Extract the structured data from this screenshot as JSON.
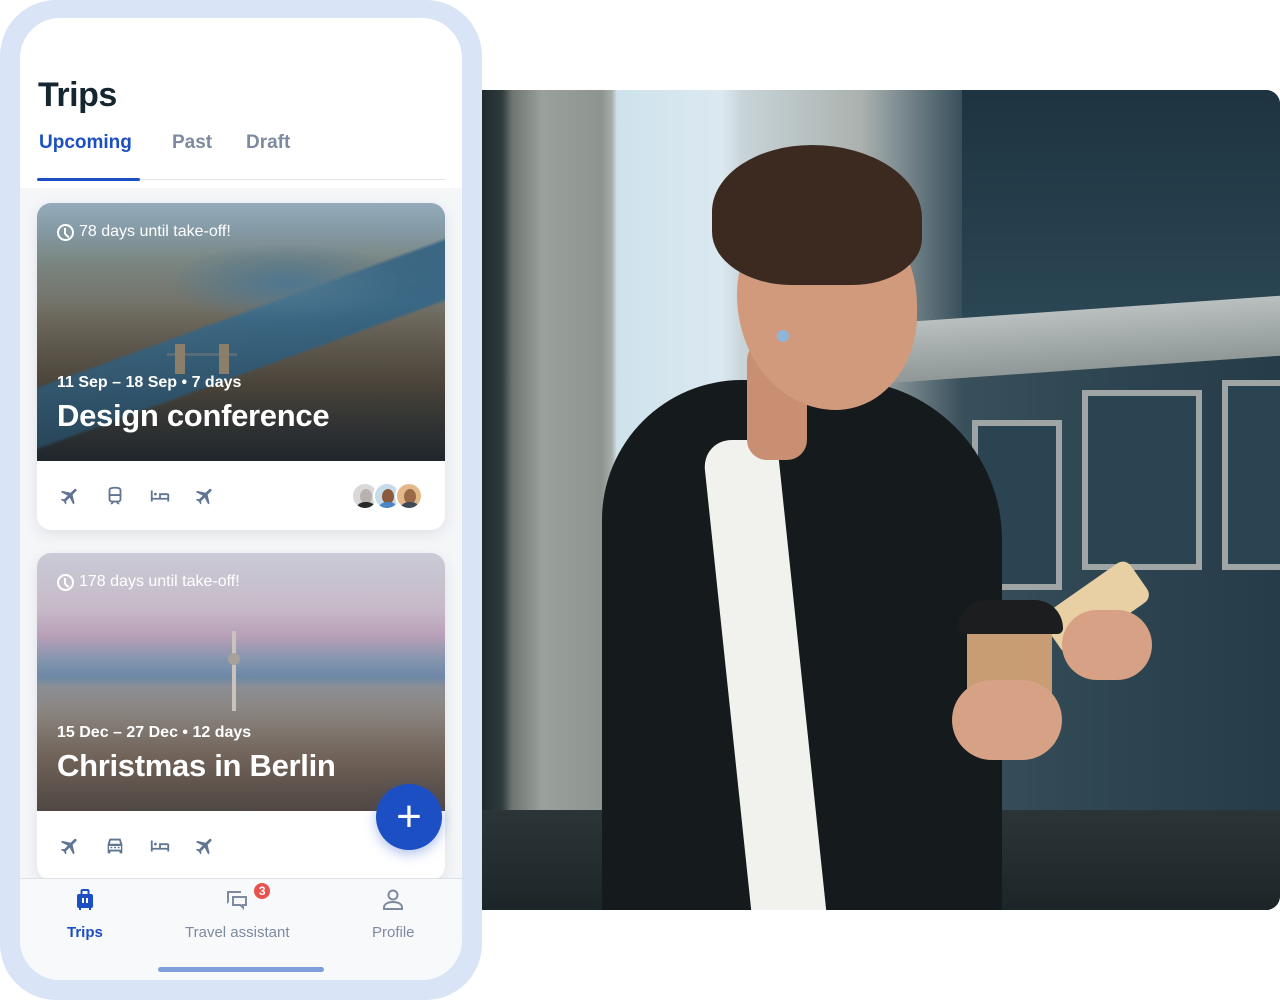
{
  "app": {
    "title": "Trips"
  },
  "tabs": [
    {
      "label": "Upcoming",
      "active": true
    },
    {
      "label": "Past",
      "active": false
    },
    {
      "label": "Draft",
      "active": false
    }
  ],
  "trips": [
    {
      "countdown": "78 days until take-off!",
      "dates": "11 Sep – 18 Sep • 7 days",
      "name": "Design conference",
      "image": "london-aerial-thames",
      "segments": [
        "plane-icon",
        "train-icon",
        "bed-icon",
        "plane-icon"
      ],
      "travelers": [
        "traveler-1",
        "traveler-2",
        "traveler-3"
      ]
    },
    {
      "countdown": "178 days until take-off!",
      "dates": "15 Dec – 27 Dec • 12 days",
      "name": "Christmas in Berlin",
      "image": "berlin-skyline-tv-tower",
      "segments": [
        "plane-icon",
        "car-icon",
        "bed-icon",
        "plane-icon"
      ]
    }
  ],
  "fab": {
    "label": "+",
    "icon": "plus-icon"
  },
  "bottom_nav": [
    {
      "label": "Trips",
      "icon": "suitcase-icon",
      "active": true
    },
    {
      "label": "Travel assistant",
      "icon": "chat-icon",
      "badge": "3",
      "active": false
    },
    {
      "label": "Profile",
      "icon": "person-icon",
      "active": false
    }
  ],
  "hero_photo": {
    "subject": "woman-with-coffee-and-phone"
  },
  "colors": {
    "accent": "#1c4fc4",
    "frame": "#d9e4f6",
    "badge": "#e8524f",
    "icon": "#5f7591",
    "title": "#14262f",
    "inactive": "#7d8aa0"
  }
}
